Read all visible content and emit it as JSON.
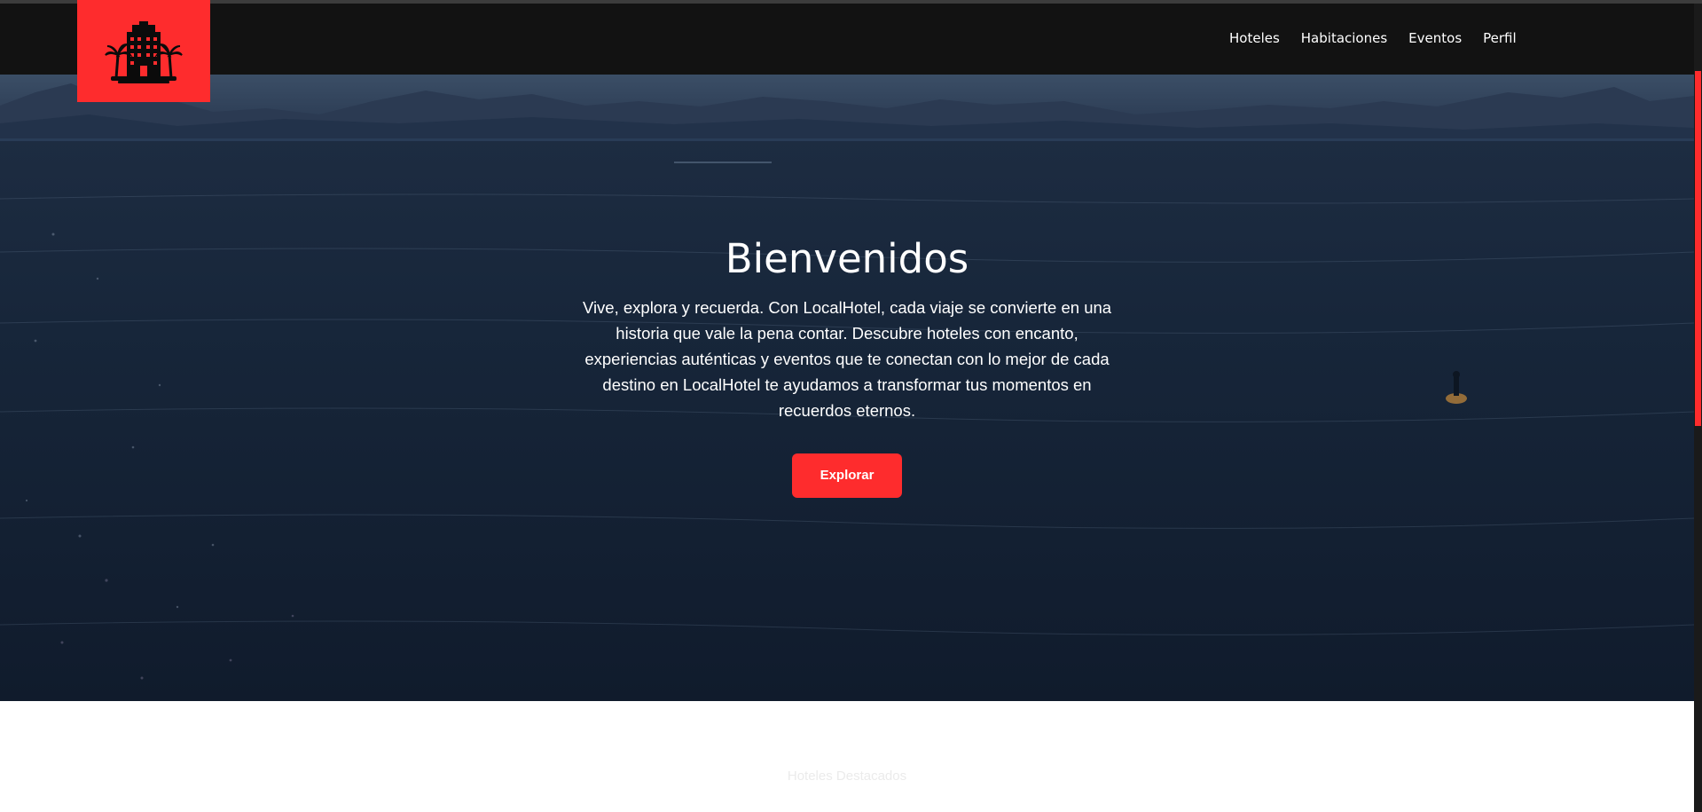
{
  "nav": {
    "logo_alt": "hotel-palm-logo",
    "links": [
      "Hoteles",
      "Habitaciones",
      "Eventos",
      "Perfil"
    ]
  },
  "hero": {
    "title": "Bienvenidos",
    "text": "Vive, explora y recuerda. Con LocalHotel, cada viaje se convierte en una historia que vale la pena contar. Descubre hoteles con encanto, experiencias auténticas y eventos que te conectan con lo mejor de cada destino en LocalHotel te ayudamos a transformar tus momentos en recuerdos eternos.",
    "button_label": "Explorar"
  },
  "section": {
    "title": "Hoteles Destacados"
  },
  "colors": {
    "accent": "#fe2c2d",
    "navbar": "#121212",
    "hero_overlay": "#152336"
  }
}
